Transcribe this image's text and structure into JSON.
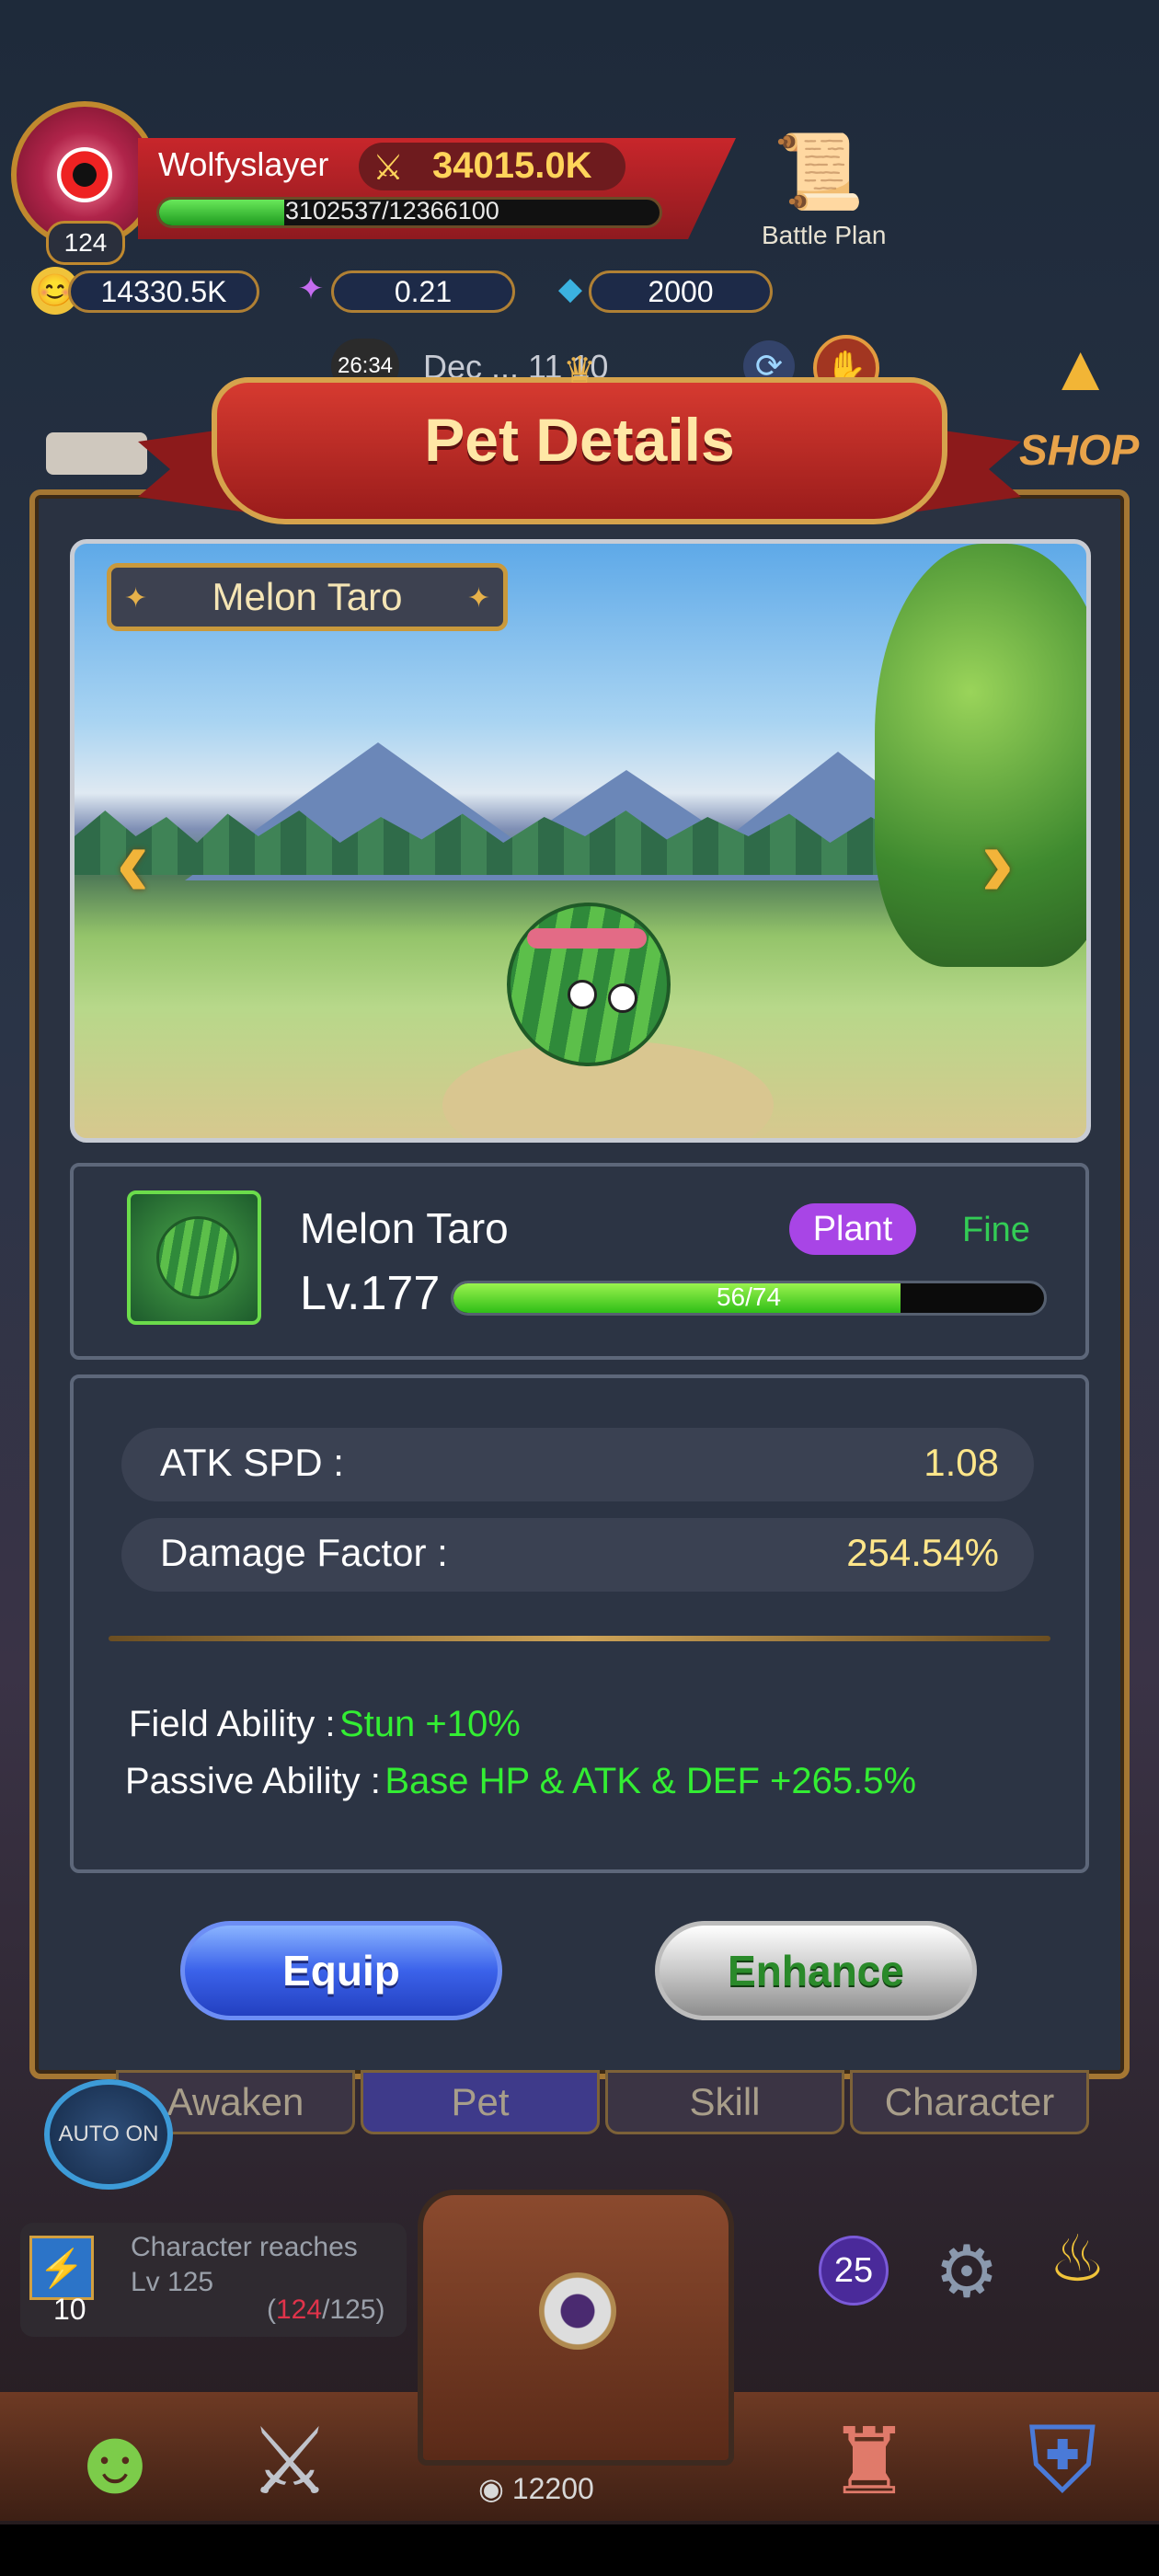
{
  "player": {
    "name": "Wolfyslayer",
    "level": "124",
    "power": "34015.0K",
    "xp_text": "3102537/12366100",
    "xp_fraction": 0.25
  },
  "resources": {
    "gold": "14330.5K",
    "stars": "0.21",
    "gems": "2000"
  },
  "battle_plan_label": "Battle Plan",
  "timer": "26:34",
  "date_text": "Dec ... 11 10",
  "shop_label": "SHOP",
  "modal": {
    "title": "Pet Details",
    "pet_banner_name": "Melon Taro"
  },
  "pet": {
    "name": "Melon Taro",
    "type": "Plant",
    "grade": "Fine",
    "level": "Lv.177",
    "exp_text": "56/74",
    "exp_fraction": 0.757
  },
  "stats": [
    {
      "label": "ATK SPD :",
      "value": "1.08"
    },
    {
      "label": "Damage Factor :",
      "value": "254.54%"
    }
  ],
  "abilities": {
    "field_label": "Field Ability :",
    "field_value": "Stun +10%",
    "passive_label": "Passive Ability :",
    "passive_value": "Base HP & ATK & DEF +265.5%"
  },
  "buttons": {
    "equip": "Equip",
    "enhance": "Enhance"
  },
  "tabs": [
    "Awaken",
    "Pet",
    "Skill",
    "Character"
  ],
  "auto_label": "AUTO ON",
  "quest": {
    "text_line1": "Character reaches",
    "text_line2": "Lv 125",
    "count": "10",
    "progress_open": "(",
    "progress_current": "124",
    "progress_rest": "/125)"
  },
  "gem_badge": "25",
  "chest_cost": "12200",
  "colors": {
    "accent_gold": "#c9993c",
    "grade_green": "#33cc55",
    "ability_green": "#33ee33",
    "type_purple": "#a845e6",
    "stat_yellow": "#ffe68a"
  },
  "icons": [
    "eye-avatar-icon",
    "sword-icon",
    "battle-plan-icon",
    "gold-coin-icon",
    "star-icon",
    "gem-icon",
    "refresh-icon",
    "handshake-icon",
    "up-arrow-icon",
    "prev-arrow-icon",
    "next-arrow-icon",
    "gear-icon",
    "lamp-icon",
    "chest-icon",
    "knight-icon",
    "crossed-swords-icon",
    "castle-icon",
    "guild-icon",
    "flag-icon"
  ]
}
